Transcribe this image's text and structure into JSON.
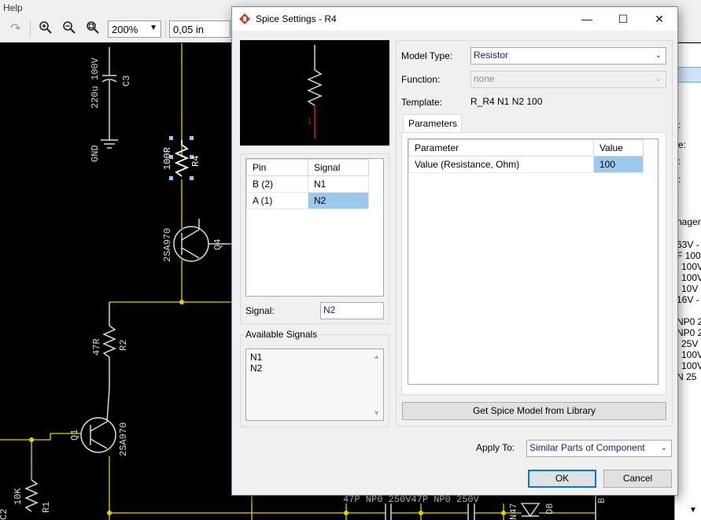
{
  "app": {
    "menu_help": "Help",
    "zoom_value": "200%",
    "grid_value": "0,05 in",
    "redo_icon": "redo-icon",
    "zoom_in_icon": "zoom-in-icon",
    "zoom_out_icon": "zoom-out-icon",
    "zoom_fit_icon": "zoom-fit-icon"
  },
  "schematic": {
    "labels": {
      "c3_value": "220u 100V",
      "c3_ref": "C3",
      "gnd": "GND",
      "r4_value": "100R",
      "r4_ref": "R4",
      "q4_value": "2SA970",
      "q4_ref": "Q4",
      "r2_value": "47R",
      "r2_ref": "R2",
      "q1_ref": "Q1",
      "q1_value": "2SA970",
      "r1_value": "10K",
      "r1_ref": "R1",
      "bottom_left": "C2",
      "bottom_caps": "47P  NP0  250V47P  NP0  250V",
      "bottom_n4": "N47",
      "bottom_d8": "D8",
      "bottom_b": "B"
    }
  },
  "right_panel": {
    "lines": [
      "e:",
      "",
      "",
      "",
      "nager",
      "63V -",
      "F 100",
      "100V",
      "100V",
      "10V",
      "16V -",
      "",
      "NP0 2",
      "NP0 2",
      "25V",
      "100V",
      "100V",
      "N 25"
    ]
  },
  "dialog": {
    "title": "Spice Settings - R4",
    "minimize": "—",
    "maximize": "☐",
    "close": "✕",
    "model_type_label": "Model Type:",
    "model_type_value": "Resistor",
    "function_label": "Function:",
    "function_value": "none",
    "template_label": "Template:",
    "template_value": "R_R4 N1 N2 100",
    "params_tab": "Parameters",
    "params_headers": [
      "Parameter",
      "Value"
    ],
    "params_rows": [
      {
        "name": "Value (Resistance, Ohm)",
        "value": "100"
      }
    ],
    "pin_headers": [
      "Pin",
      "Signal"
    ],
    "pin_rows": [
      {
        "pin": "B (2)",
        "signal": "N1"
      },
      {
        "pin": "A (1)",
        "signal": "N2"
      }
    ],
    "signal_label": "Signal:",
    "signal_value": "N2",
    "available_signals_label": "Available Signals",
    "available_signals": [
      "N1",
      "N2"
    ],
    "get_model_button": "Get Spice Model from Library",
    "apply_to_label": "Apply To:",
    "apply_to_value": "Similar Parts of Component",
    "ok_button": "OK",
    "cancel_button": "Cancel",
    "preview_pin_number": "1"
  }
}
